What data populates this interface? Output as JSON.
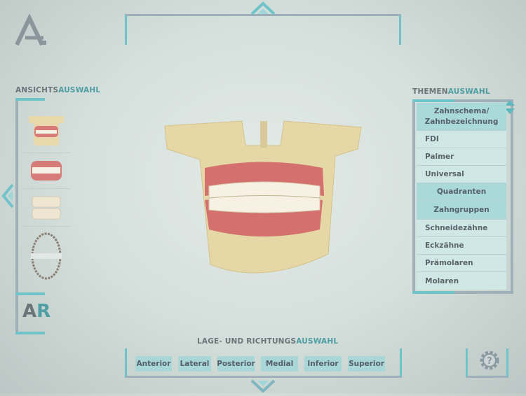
{
  "logo": "A",
  "view_selection": {
    "title_a": "ANSICHTS",
    "title_b": "AUSWAHL",
    "thumbnails": [
      "full-model",
      "dentition-with-gums",
      "teeth-only",
      "occlusal-view"
    ],
    "ar_a": "A",
    "ar_b": "R"
  },
  "topics": {
    "title_a": "THEMEN",
    "title_b": "AUSWAHL",
    "items": [
      {
        "label": "Zahnschema/ Zahnbezeichnung",
        "type": "section"
      },
      {
        "label": "FDI",
        "type": "item"
      },
      {
        "label": "Palmer",
        "type": "item"
      },
      {
        "label": "Universal",
        "type": "item"
      },
      {
        "label": "Quadranten",
        "type": "section"
      },
      {
        "label": "Zahngruppen",
        "type": "section"
      },
      {
        "label": "Schneidezähne",
        "type": "item"
      },
      {
        "label": "Eckzähne",
        "type": "item"
      },
      {
        "label": "Prämolaren",
        "type": "item"
      },
      {
        "label": "Molaren",
        "type": "item"
      }
    ]
  },
  "direction": {
    "title_a": "LAGE- UND RICHTUNGS",
    "title_b": "AUSWAHL",
    "buttons": [
      "Anterior",
      "Lateral",
      "Posterior",
      "Medial",
      "Inferior",
      "Superior"
    ]
  },
  "colors": {
    "accent": "#5cc4c8",
    "frame": "#9aa8b4",
    "tab": "#a9d6d6"
  }
}
